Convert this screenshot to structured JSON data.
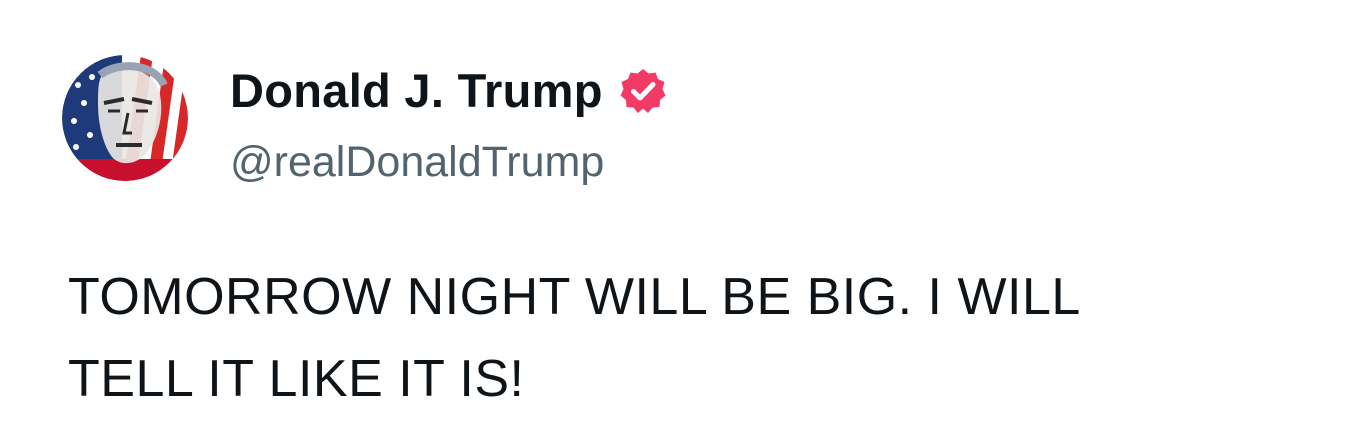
{
  "author": {
    "display_name": "Donald J. Trump",
    "handle": "@realDonaldTrump",
    "verified": true,
    "avatar_icon": "flag-portrait-avatar",
    "badge_icon": "verified-check-icon"
  },
  "post": {
    "text": "TOMORROW NIGHT WILL BE BIG. I WILL\nTELL IT LIKE IT IS!"
  },
  "colors": {
    "badge": "#f23a67",
    "handle": "#536471",
    "text": "#0f1419"
  }
}
